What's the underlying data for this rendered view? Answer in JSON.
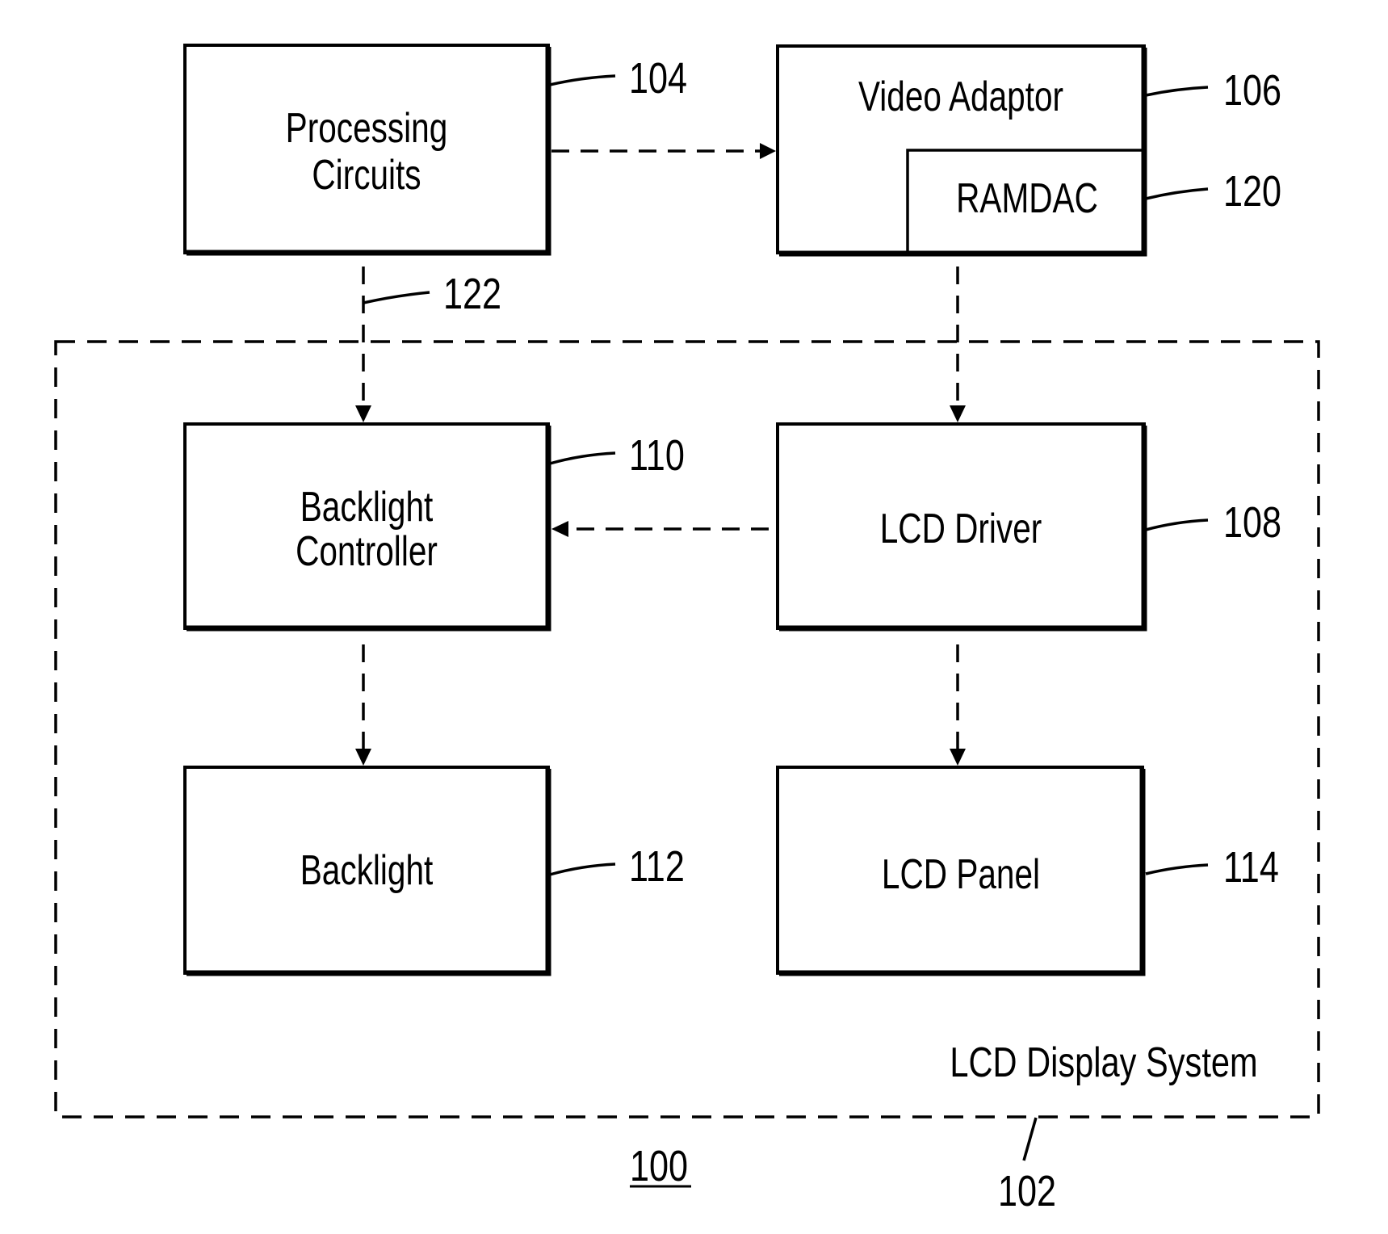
{
  "diagram": {
    "blocks": {
      "processing": {
        "line1": "Processing",
        "line2": "Circuits",
        "ref": "104"
      },
      "video_adaptor": {
        "label": "Video Adaptor",
        "ref": "106"
      },
      "ramdac": {
        "label": "RAMDAC",
        "ref": "120"
      },
      "backlight_controller": {
        "line1": "Backlight",
        "line2": "Controller",
        "ref": "110"
      },
      "lcd_driver": {
        "label": "LCD Driver",
        "ref": "108"
      },
      "backlight": {
        "label": "Backlight",
        "ref": "112"
      },
      "lcd_panel": {
        "label": "LCD Panel",
        "ref": "114"
      }
    },
    "connection_ref": "122",
    "system": {
      "label": "LCD Display System",
      "ref": "102"
    },
    "figure_ref": "100",
    "edges": [
      {
        "from": "Processing Circuits",
        "to": "Video Adaptor"
      },
      {
        "from": "Processing Circuits",
        "to": "Backlight Controller"
      },
      {
        "from": "RAMDAC",
        "to": "LCD Driver"
      },
      {
        "from": "LCD Driver",
        "to": "Backlight Controller"
      },
      {
        "from": "Backlight Controller",
        "to": "Backlight"
      },
      {
        "from": "LCD Driver",
        "to": "LCD Panel"
      }
    ]
  }
}
